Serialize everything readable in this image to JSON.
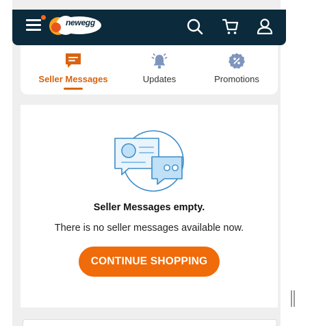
{
  "header": {
    "logo_text": "newegg",
    "icons": [
      "menu-icon",
      "search-icon",
      "cart-icon",
      "user-icon"
    ],
    "bg_color": "#0b2a3c",
    "notification_color": "#f7691d"
  },
  "tabs": [
    {
      "label": "Seller Messages",
      "icon": "chat-icon",
      "active": true
    },
    {
      "label": "Updates",
      "icon": "bell-icon",
      "active": false
    },
    {
      "label": "Promotions",
      "icon": "discount-badge-icon",
      "active": false
    }
  ],
  "empty_state": {
    "illustration": "chat-bubbles-illustration",
    "title": "Seller Messages empty.",
    "description": "There is no seller messages available now.",
    "button_label": "CONTINUE SHOPPING"
  },
  "colors": {
    "accent": "#f06b0a",
    "active_tab": "#d9630f"
  }
}
